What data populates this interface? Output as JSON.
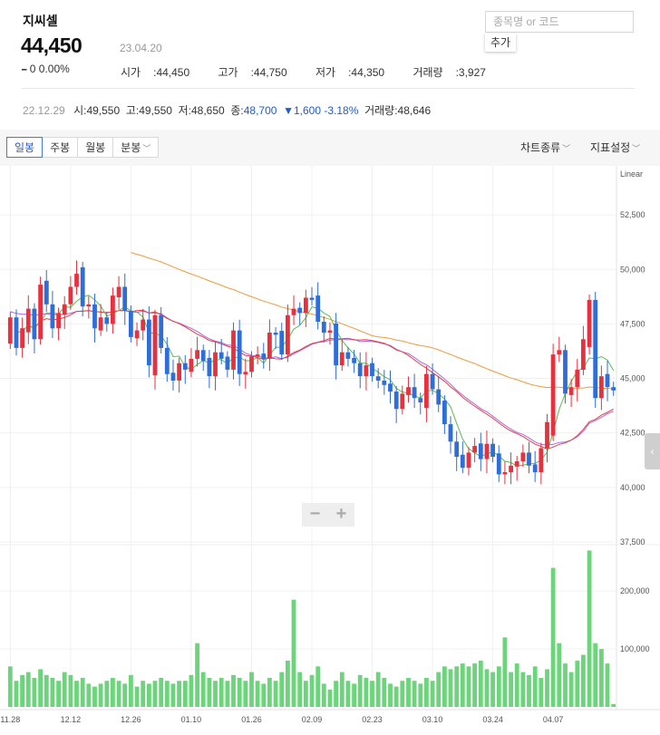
{
  "stock": {
    "name": "지씨셀",
    "price": "44,450",
    "date": "23.04.20",
    "change": "0 0.00%",
    "change_mark": "━",
    "open_label": "시가",
    "open": "44,450",
    "high_label": "고가",
    "high": "44,750",
    "low_label": "저가",
    "low": "44,350",
    "volume_label": "거래량",
    "volume": "3,927"
  },
  "search": {
    "placeholder": "종목명 or 코드",
    "add_label": "추가"
  },
  "prev": {
    "date": "22.12.29",
    "open_label": "시",
    "open": "49,550",
    "high_label": "고",
    "high": "49,550",
    "low_label": "저",
    "low": "48,650",
    "close_label": "종",
    "close": "48,700",
    "diff": "▼1,600 -3.18%",
    "volume_label": "거래량",
    "volume": "48,646"
  },
  "toolbar": {
    "tabs": [
      "일봉",
      "주봉",
      "월봉",
      "분봉"
    ],
    "chart_type": "차트종류",
    "indicator": "지표설정"
  },
  "colors": {
    "up": "#e8313f",
    "down": "#2f6dd8",
    "volume": "#6cd47a",
    "ma5": "#5abe4e",
    "ma20": "#e04040",
    "ma60": "#b066e0",
    "ma120": "#ef9a3a"
  },
  "chart_data": {
    "type": "candlestick",
    "scale_label": "Linear",
    "price_ticks": [
      37500,
      40000,
      42500,
      45000,
      47500,
      50000,
      52500
    ],
    "price_tick_labels": [
      "37,500",
      "40,000",
      "42,500",
      "45,000",
      "47,500",
      "50,000",
      "52,500"
    ],
    "price_range": [
      37500,
      54500
    ],
    "volume_ticks": [
      100000,
      200000
    ],
    "volume_tick_labels": [
      "100,000",
      "200,000"
    ],
    "volume_range": [
      0,
      280000
    ],
    "date_labels": [
      {
        "label": "11.28",
        "index": 0
      },
      {
        "label": "12.12",
        "index": 10
      },
      {
        "label": "12.26",
        "index": 20
      },
      {
        "label": "01.10",
        "index": 30
      },
      {
        "label": "01.26",
        "index": 40
      },
      {
        "label": "02.09",
        "index": 50
      },
      {
        "label": "02.23",
        "index": 60
      },
      {
        "label": "03.10",
        "index": 70
      },
      {
        "label": "03.24",
        "index": 80
      },
      {
        "label": "04.07",
        "index": 90
      }
    ],
    "close": [
      47800,
      46400,
      47300,
      48200,
      46800,
      49300,
      48400,
      47300,
      48000,
      48400,
      49200,
      49800,
      48300,
      48400,
      47300,
      47800,
      47500,
      48800,
      49200,
      48100,
      46900,
      47200,
      47700,
      45600,
      47900,
      46400,
      45200,
      44900,
      45700,
      45400,
      45900,
      46300,
      45800,
      45100,
      46200,
      45900,
      45400,
      47200,
      45200,
      45300,
      46000,
      46100,
      45900,
      47100,
      47000,
      46100,
      47900,
      48200,
      48000,
      48700,
      48600,
      47600,
      47100,
      47200,
      45600,
      46200,
      45900,
      45700,
      45100,
      45600,
      45100,
      44900,
      44700,
      44400,
      43600,
      44300,
      44600,
      44100,
      43900,
      45200,
      44500,
      43800,
      42900,
      42100,
      41400,
      40900,
      41600,
      41900,
      41300,
      42000,
      41400,
      40600,
      40700,
      41000,
      41200,
      41600,
      41000,
      40700,
      41800,
      43000,
      46100,
      46300,
      44300,
      44600,
      45400,
      46800,
      48600,
      44100,
      45100,
      44600,
      44450
    ],
    "volume": [
      70000,
      45000,
      55000,
      60000,
      50000,
      65000,
      55000,
      50000,
      45000,
      60000,
      55000,
      45000,
      50000,
      40000,
      35000,
      40000,
      45000,
      50000,
      45000,
      40000,
      55000,
      35000,
      45000,
      40000,
      45000,
      50000,
      45000,
      40000,
      45000,
      45000,
      55000,
      110000,
      60000,
      50000,
      45000,
      50000,
      45000,
      55000,
      50000,
      45000,
      60000,
      45000,
      40000,
      50000,
      45000,
      60000,
      80000,
      185000,
      60000,
      45000,
      55000,
      70000,
      40000,
      30000,
      45000,
      60000,
      45000,
      40000,
      55000,
      50000,
      45000,
      60000,
      50000,
      40000,
      35000,
      45000,
      50000,
      45000,
      40000,
      50000,
      45000,
      60000,
      70000,
      65000,
      70000,
      75000,
      70000,
      75000,
      80000,
      65000,
      60000,
      70000,
      120000,
      60000,
      75000,
      60000,
      55000,
      70000,
      50000,
      65000,
      240000,
      110000,
      75000,
      60000,
      80000,
      90000,
      270000,
      110000,
      100000,
      75000,
      5000
    ]
  }
}
